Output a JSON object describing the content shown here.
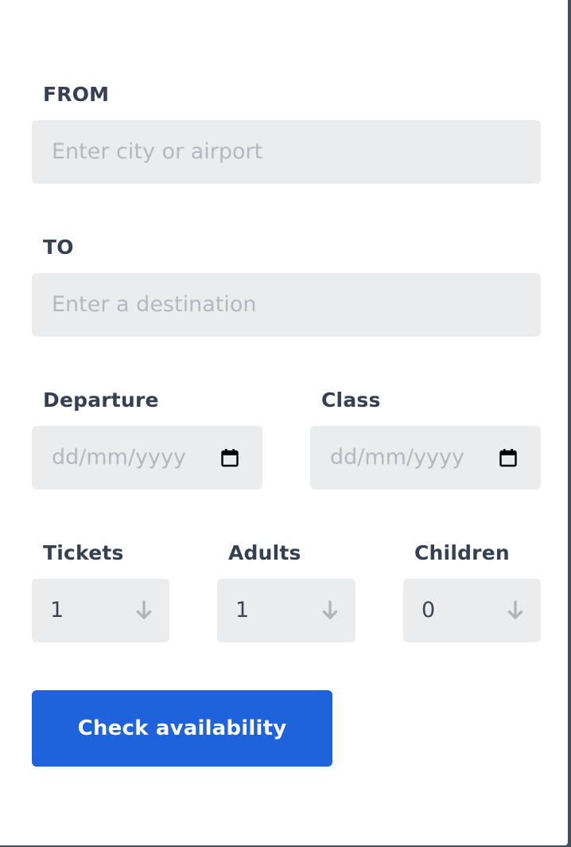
{
  "from": {
    "label": "FROM",
    "placeholder": "Enter city or airport"
  },
  "to": {
    "label": "TO",
    "placeholder": "Enter a destination"
  },
  "departure": {
    "label": "Departure",
    "placeholder": "dd/mm/yyyy",
    "icon": "calendar-icon"
  },
  "class": {
    "label": "Class",
    "placeholder": "dd/mm/yyyy",
    "icon": "calendar-icon"
  },
  "tickets": {
    "label": "Tickets",
    "value": "1",
    "icon": "arrow-down-icon"
  },
  "adults": {
    "label": "Adults",
    "value": "1",
    "icon": "arrow-down-icon"
  },
  "children": {
    "label": "Children",
    "value": "0",
    "icon": "arrow-down-icon"
  },
  "submit": {
    "label": "Check availability"
  },
  "colors": {
    "accent": "#1e63db",
    "field_bg": "#ebecee",
    "label_text": "#354052",
    "placeholder_text": "#b5b8bd",
    "background_edge": "#3d4f60"
  }
}
